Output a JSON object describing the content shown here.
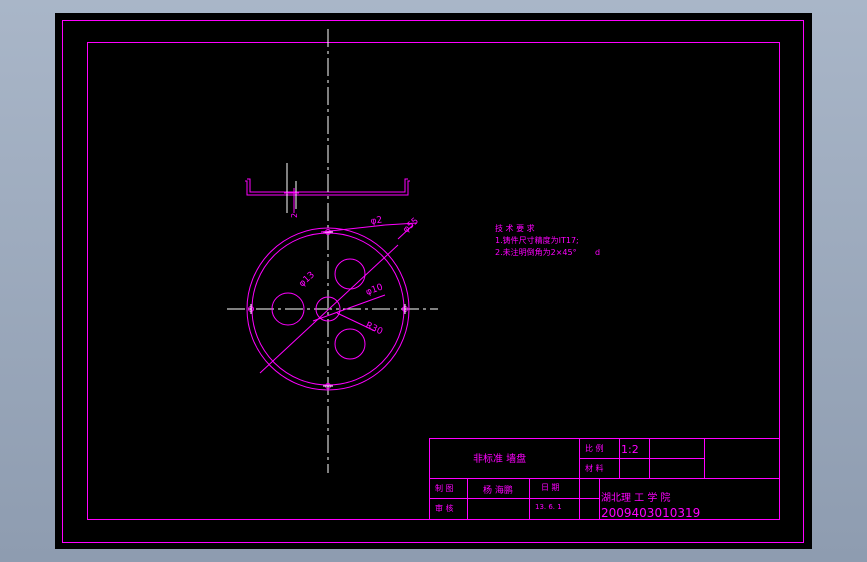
{
  "colors": {
    "background": "#8e9cb0",
    "viewport": "#000000",
    "line": "#ff00ff",
    "centerline": "#ffffff"
  },
  "dimensions": {
    "thickness": "2",
    "hole_small": "φ2",
    "outer": "φ55",
    "hole_13": "φ13",
    "center_hole": "φ10",
    "pitch": "R30"
  },
  "notes": {
    "title": "技 术 要 求",
    "line1": "1.铸件尺寸精度为IT17;",
    "line2": "2.未注明倒角为2×45°",
    "suffix": "d"
  },
  "title_block": {
    "part_name": "非标准 墙盘",
    "scale_label": "比 例",
    "scale_value": "1:2",
    "material_label": "材 料",
    "drawn_label": "制 图",
    "drawer_name": "杨 海鹏",
    "date_label": "日 期",
    "date_value": "13. 6. 1",
    "check_label": "审 核",
    "school": "湖北理 工 学 院",
    "student_id": "2009403010319"
  }
}
